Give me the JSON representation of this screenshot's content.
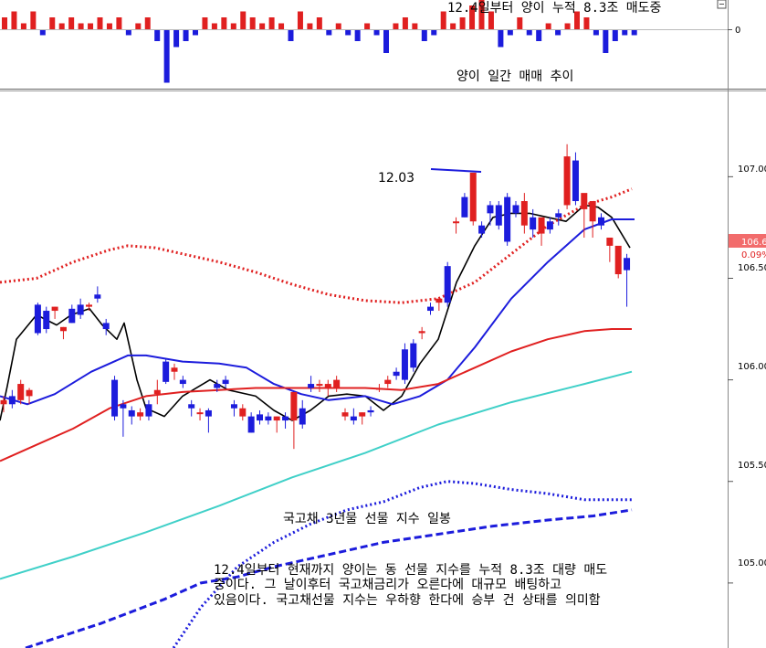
{
  "chart_data": [
    {
      "type": "bar",
      "title": "양이 일간 매매 추이",
      "header_note": "12.4일부터 양이 누적 8.3조 매도중",
      "y_ticks": [
        "0"
      ],
      "values": [
        2,
        3,
        1,
        3,
        -1,
        2,
        1,
        2,
        1,
        1,
        2,
        1,
        2,
        -1,
        1,
        2,
        -2,
        -9,
        -3,
        -2,
        -1,
        2,
        1,
        2,
        1,
        3,
        2,
        1,
        2,
        1,
        -2,
        3,
        1,
        2,
        -1,
        1,
        -1,
        -2,
        1,
        -1,
        -4,
        1,
        2,
        1,
        -2,
        -1,
        3,
        1,
        2,
        4,
        5,
        3,
        -3,
        -1,
        2,
        -1,
        -2,
        1,
        -1,
        1,
        3,
        2,
        -1,
        -4,
        -2,
        -1,
        -1
      ],
      "colors": {
        "up": "#e02020",
        "down": "#1c1cdc"
      }
    },
    {
      "type": "candlestick",
      "title": "국고채 3년물 선물 지수 일봉",
      "y_ticks": [
        "107.00",
        "106.50",
        "106.00",
        "105.50",
        "105.00"
      ],
      "ylim": [
        104.68,
        107.42
      ],
      "last_price": "106.6",
      "last_change": "0.09%",
      "annotation": "12.03",
      "note_lines": [
        "12.4일부터 현재까지 양이는 동 선물 지수를 누적 8.3조 대량 매도",
        "중이다. 그 날이후터 국고채금리가 오른다에 대규모 배팅하고",
        "있음이다. 국고채선물 지수는 우하향 한다에 승부 건 상태를 의미함"
      ],
      "candles": [
        [
          105.88,
          105.92,
          105.84,
          105.9
        ],
        [
          105.92,
          105.95,
          105.86,
          105.88
        ],
        [
          105.9,
          106.0,
          105.88,
          105.98
        ],
        [
          105.92,
          105.96,
          105.88,
          105.95
        ],
        [
          106.37,
          106.38,
          106.22,
          106.23
        ],
        [
          106.34,
          106.36,
          106.23,
          106.25
        ],
        [
          106.34,
          106.36,
          106.3,
          106.36
        ],
        [
          106.24,
          106.26,
          106.2,
          106.26
        ],
        [
          106.35,
          106.37,
          106.28,
          106.28
        ],
        [
          106.37,
          106.4,
          106.3,
          106.32
        ],
        [
          106.36,
          106.38,
          106.34,
          106.37
        ],
        [
          106.42,
          106.46,
          106.38,
          106.4
        ],
        [
          106.28,
          106.3,
          106.22,
          106.25
        ],
        [
          106.0,
          106.02,
          105.8,
          105.82
        ],
        [
          105.88,
          105.9,
          105.72,
          105.86
        ],
        [
          105.85,
          105.87,
          105.78,
          105.82
        ],
        [
          105.82,
          105.86,
          105.8,
          105.84
        ],
        [
          105.88,
          105.9,
          105.8,
          105.82
        ],
        [
          105.93,
          106.0,
          105.88,
          105.95
        ],
        [
          106.09,
          106.1,
          105.98,
          105.99
        ],
        [
          106.04,
          106.08,
          106.0,
          106.06
        ],
        [
          106.0,
          106.02,
          105.96,
          105.98
        ],
        [
          105.88,
          105.9,
          105.82,
          105.86
        ],
        [
          105.84,
          105.86,
          105.8,
          105.84
        ],
        [
          105.85,
          105.86,
          105.74,
          105.82
        ],
        [
          105.98,
          106.0,
          105.94,
          105.96
        ],
        [
          106.0,
          106.02,
          105.96,
          105.98
        ],
        [
          105.88,
          105.9,
          105.82,
          105.86
        ],
        [
          105.82,
          105.88,
          105.8,
          105.86
        ],
        [
          105.82,
          105.84,
          105.74,
          105.74
        ],
        [
          105.83,
          105.85,
          105.78,
          105.8
        ],
        [
          105.82,
          105.84,
          105.78,
          105.8
        ],
        [
          105.8,
          105.82,
          105.74,
          105.82
        ],
        [
          105.82,
          105.84,
          105.76,
          105.8
        ],
        [
          105.8,
          105.9,
          105.66,
          105.94
        ],
        [
          105.86,
          105.9,
          105.76,
          105.78
        ],
        [
          105.98,
          106.02,
          105.94,
          105.96
        ],
        [
          105.98,
          106.0,
          105.94,
          105.98
        ],
        [
          105.96,
          106.0,
          105.92,
          105.98
        ],
        [
          105.96,
          106.02,
          105.94,
          106.0
        ],
        [
          105.82,
          105.86,
          105.8,
          105.84
        ],
        [
          105.82,
          105.86,
          105.78,
          105.8
        ],
        [
          105.82,
          105.84,
          105.78,
          105.84
        ],
        [
          105.85,
          105.87,
          105.82,
          105.84
        ],
        [
          105.96,
          105.98,
          105.94,
          105.96
        ],
        [
          105.98,
          106.02,
          105.96,
          106.0
        ],
        [
          106.04,
          106.06,
          106.0,
          106.02
        ],
        [
          106.15,
          106.18,
          105.98,
          106.0
        ],
        [
          106.18,
          106.2,
          106.04,
          106.06
        ],
        [
          106.23,
          106.26,
          106.2,
          106.24
        ],
        [
          106.36,
          106.38,
          106.32,
          106.34
        ],
        [
          106.38,
          106.4,
          106.34,
          106.4
        ],
        [
          106.56,
          106.58,
          106.36,
          106.38
        ],
        [
          106.78,
          106.8,
          106.72,
          106.78
        ],
        [
          106.9,
          106.92,
          106.8,
          106.8
        ],
        [
          106.78,
          106.84,
          106.76,
          107.02
        ],
        [
          106.76,
          106.78,
          106.7,
          106.72
        ],
        [
          106.86,
          106.88,
          106.76,
          106.82
        ],
        [
          106.86,
          106.88,
          106.74,
          106.76
        ],
        [
          106.9,
          106.92,
          106.66,
          106.68
        ],
        [
          106.86,
          106.88,
          106.8,
          106.82
        ],
        [
          106.76,
          106.92,
          106.72,
          106.88
        ],
        [
          106.8,
          106.84,
          106.7,
          106.74
        ],
        [
          106.72,
          106.74,
          106.66,
          106.8
        ],
        [
          106.78,
          106.8,
          106.72,
          106.74
        ],
        [
          106.82,
          106.84,
          106.76,
          106.8
        ],
        [
          106.86,
          107.16,
          106.84,
          107.1
        ],
        [
          107.08,
          107.12,
          106.86,
          106.88
        ],
        [
          106.84,
          106.86,
          106.7,
          106.92
        ],
        [
          106.78,
          106.82,
          106.7,
          106.88
        ],
        [
          106.8,
          106.82,
          106.74,
          106.76
        ],
        [
          106.66,
          106.68,
          106.58,
          106.7
        ],
        [
          106.52,
          106.54,
          106.5,
          106.66
        ],
        [
          106.6,
          106.62,
          106.36,
          106.54
        ]
      ],
      "series": [
        {
          "key": "ma5",
          "color": "#000000",
          "style": "solid",
          "values": [
            [
              0,
              105.8
            ],
            [
              8,
              105.97
            ],
            [
              18,
              106.2
            ],
            [
              40,
              106.32
            ],
            [
              62,
              106.27
            ],
            [
              78,
              106.32
            ],
            [
              98,
              106.35
            ],
            [
              112,
              106.27
            ],
            [
              128,
              106.2
            ],
            [
              136,
              106.28
            ],
            [
              150,
              106.0
            ],
            [
              160,
              105.86
            ],
            [
              180,
              105.82
            ],
            [
              200,
              105.92
            ],
            [
              230,
              106.0
            ],
            [
              250,
              105.95
            ],
            [
              280,
              105.92
            ],
            [
              300,
              105.85
            ],
            [
              320,
              105.8
            ],
            [
              340,
              105.85
            ],
            [
              360,
              105.92
            ],
            [
              380,
              105.93
            ],
            [
              400,
              105.92
            ],
            [
              420,
              105.85
            ],
            [
              440,
              105.92
            ],
            [
              460,
              106.08
            ],
            [
              480,
              106.2
            ],
            [
              500,
              106.48
            ],
            [
              520,
              106.66
            ],
            [
              540,
              106.8
            ],
            [
              560,
              106.82
            ],
            [
              580,
              106.82
            ],
            [
              600,
              106.8
            ],
            [
              620,
              106.78
            ],
            [
              640,
              106.86
            ],
            [
              655,
              106.85
            ],
            [
              670,
              106.8
            ],
            [
              690,
              106.65
            ]
          ]
        },
        {
          "key": "ma10",
          "color": "#1c1cdc",
          "style": "solid",
          "values": [
            [
              0,
              105.92
            ],
            [
              30,
              105.88
            ],
            [
              60,
              105.93
            ],
            [
              100,
              106.04
            ],
            [
              140,
              106.12
            ],
            [
              160,
              106.12
            ],
            [
              200,
              106.09
            ],
            [
              240,
              106.08
            ],
            [
              270,
              106.06
            ],
            [
              300,
              105.98
            ],
            [
              330,
              105.93
            ],
            [
              360,
              105.9
            ],
            [
              400,
              105.92
            ],
            [
              430,
              105.88
            ],
            [
              460,
              105.92
            ],
            [
              490,
              106.0
            ],
            [
              520,
              106.16
            ],
            [
              560,
              106.4
            ],
            [
              600,
              106.58
            ],
            [
              640,
              106.74
            ],
            [
              670,
              106.79
            ],
            [
              695,
              106.79
            ]
          ]
        },
        {
          "key": "ma20",
          "color": "#e02020",
          "style": "solid",
          "values": [
            [
              0,
              105.6
            ],
            [
              40,
              105.68
            ],
            [
              80,
              105.76
            ],
            [
              120,
              105.86
            ],
            [
              160,
              105.92
            ],
            [
              200,
              105.94
            ],
            [
              240,
              105.95
            ],
            [
              280,
              105.96
            ],
            [
              320,
              105.96
            ],
            [
              360,
              105.96
            ],
            [
              400,
              105.96
            ],
            [
              440,
              105.95
            ],
            [
              480,
              105.98
            ],
            [
              520,
              106.06
            ],
            [
              560,
              106.14
            ],
            [
              600,
              106.2
            ],
            [
              640,
              106.24
            ],
            [
              670,
              106.25
            ],
            [
              692,
              106.25
            ]
          ]
        },
        {
          "key": "ma60",
          "color": "#40d0c8",
          "style": "solid",
          "values": [
            [
              0,
              105.02
            ],
            [
              80,
              105.13
            ],
            [
              160,
              105.25
            ],
            [
              240,
              105.38
            ],
            [
              320,
              105.52
            ],
            [
              400,
              105.64
            ],
            [
              480,
              105.78
            ],
            [
              560,
              105.89
            ],
            [
              640,
              105.98
            ],
            [
              692,
              106.04
            ]
          ]
        },
        {
          "key": "band_upper",
          "color": "#e02020",
          "style": "dot",
          "values": [
            [
              0,
              106.48
            ],
            [
              40,
              106.5
            ],
            [
              80,
              106.58
            ],
            [
              120,
              106.64
            ],
            [
              140,
              106.66
            ],
            [
              170,
              106.65
            ],
            [
              200,
              106.62
            ],
            [
              240,
              106.58
            ],
            [
              280,
              106.53
            ],
            [
              320,
              106.47
            ],
            [
              360,
              106.42
            ],
            [
              400,
              106.39
            ],
            [
              440,
              106.38
            ],
            [
              480,
              106.4
            ],
            [
              520,
              106.48
            ],
            [
              560,
              106.62
            ],
            [
              600,
              106.76
            ],
            [
              640,
              106.86
            ],
            [
              670,
              106.9
            ],
            [
              692,
              106.94
            ]
          ]
        },
        {
          "key": "band_lower",
          "color": "#1c1cdc",
          "style": "dot",
          "values": [
            [
              190,
              104.68
            ],
            [
              220,
              104.88
            ],
            [
              260,
              105.08
            ],
            [
              300,
              105.2
            ],
            [
              340,
              105.29
            ],
            [
              380,
              105.36
            ],
            [
              420,
              105.4
            ],
            [
              460,
              105.47
            ],
            [
              490,
              105.5
            ],
            [
              520,
              105.49
            ],
            [
              560,
              105.46
            ],
            [
              600,
              105.44
            ],
            [
              640,
              105.41
            ],
            [
              692,
              105.41
            ]
          ]
        },
        {
          "key": "trend",
          "color": "#1c1cdc",
          "style": "dash",
          "values": [
            [
              28,
              104.68
            ],
            [
              110,
              104.8
            ],
            [
              180,
              104.92
            ],
            [
              220,
              105.0
            ],
            [
              260,
              105.03
            ],
            [
              300,
              105.08
            ],
            [
              360,
              105.14
            ],
            [
              420,
              105.2
            ],
            [
              480,
              105.24
            ],
            [
              540,
              105.28
            ],
            [
              600,
              105.31
            ],
            [
              650,
              105.33
            ],
            [
              692,
              105.36
            ]
          ]
        }
      ]
    }
  ]
}
